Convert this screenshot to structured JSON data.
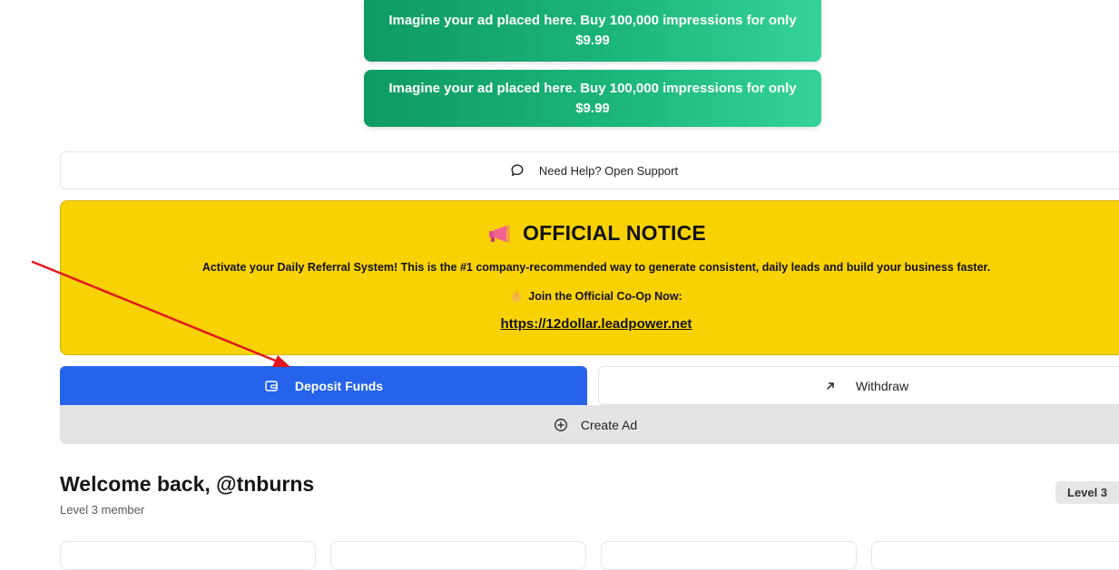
{
  "ads": [
    {
      "text": "Imagine your ad placed here. Buy 100,000 impressions for only $9.99"
    },
    {
      "text": "Imagine your ad placed here. Buy 100,000 impressions for only $9.99"
    }
  ],
  "support": {
    "icon": "chat-bubble-icon",
    "label": "Need Help? Open Support"
  },
  "notice": {
    "icon": "megaphone-icon",
    "title": "OFFICIAL NOTICE",
    "body": "Activate your Daily Referral System! This is the #1 company-recommended way to generate consistent, daily leads and build your business faster.",
    "cta_icon": "pointing-hand-icon",
    "cta": "Join the Official Co-Op Now:",
    "link": "https://12dollar.leadpower.net",
    "background": "#f9d206"
  },
  "actions": {
    "deposit": {
      "label": "Deposit Funds",
      "icon": "wallet-icon",
      "color": "#2563eb"
    },
    "withdraw": {
      "label": "Withdraw",
      "icon": "arrow-up-right-icon"
    },
    "create_ad": {
      "label": "Create Ad",
      "icon": "plus-circle-icon"
    }
  },
  "welcome": {
    "title": "Welcome back, @tnburns",
    "subtitle": "Level 3 member",
    "badge": "Level 3"
  },
  "colors": {
    "ad_green": "#1bb679",
    "annotation_arrow": "#e0191f"
  }
}
